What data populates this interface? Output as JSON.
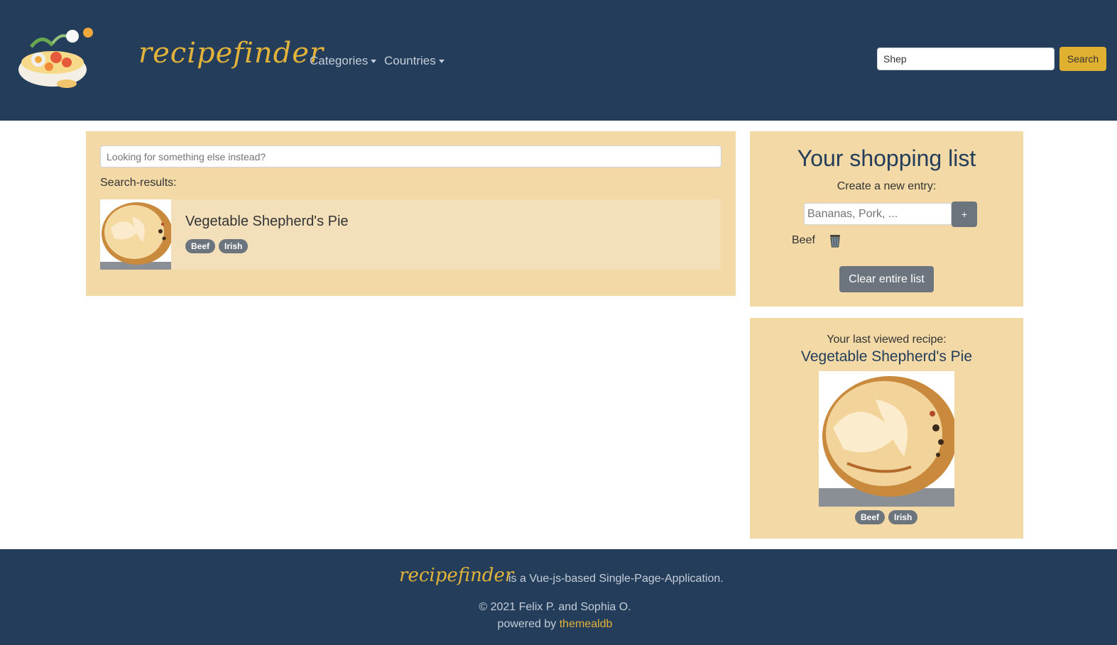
{
  "header": {
    "brand": "recipefinder",
    "nav": [
      {
        "label": "Categories"
      },
      {
        "label": "Countries"
      }
    ],
    "search": {
      "value": "Shep",
      "button_label": "Search"
    }
  },
  "results": {
    "search_placeholder": "Looking for something else instead?",
    "label": "Search-results:",
    "items": [
      {
        "title": "Vegetable Shepherd's Pie",
        "tags": [
          "Beef",
          "Irish"
        ]
      }
    ]
  },
  "shopping_list": {
    "title": "Your shopping list",
    "subtitle": "Create a new entry:",
    "input_placeholder": "Bananas, Pork, ...",
    "add_label": "+",
    "items": [
      {
        "name": "Beef"
      }
    ],
    "clear_label": "Clear entire list"
  },
  "last_viewed": {
    "label": "Your last viewed recipe:",
    "title": "Vegetable Shepherd's Pie",
    "tags": [
      "Beef",
      "Irish"
    ]
  },
  "footer": {
    "brand": "recipefinder",
    "description": "is a Vue-js-based Single-Page-Application.",
    "copyright": "© 2021 Felix P. and Sophia O.",
    "powered_prefix": "powered by",
    "powered_link": "themealdb"
  },
  "colors": {
    "header_bg": "#233d5a",
    "panel_bg": "#f2d9a5",
    "accent": "#e2b33a",
    "badge": "#6c757d"
  }
}
